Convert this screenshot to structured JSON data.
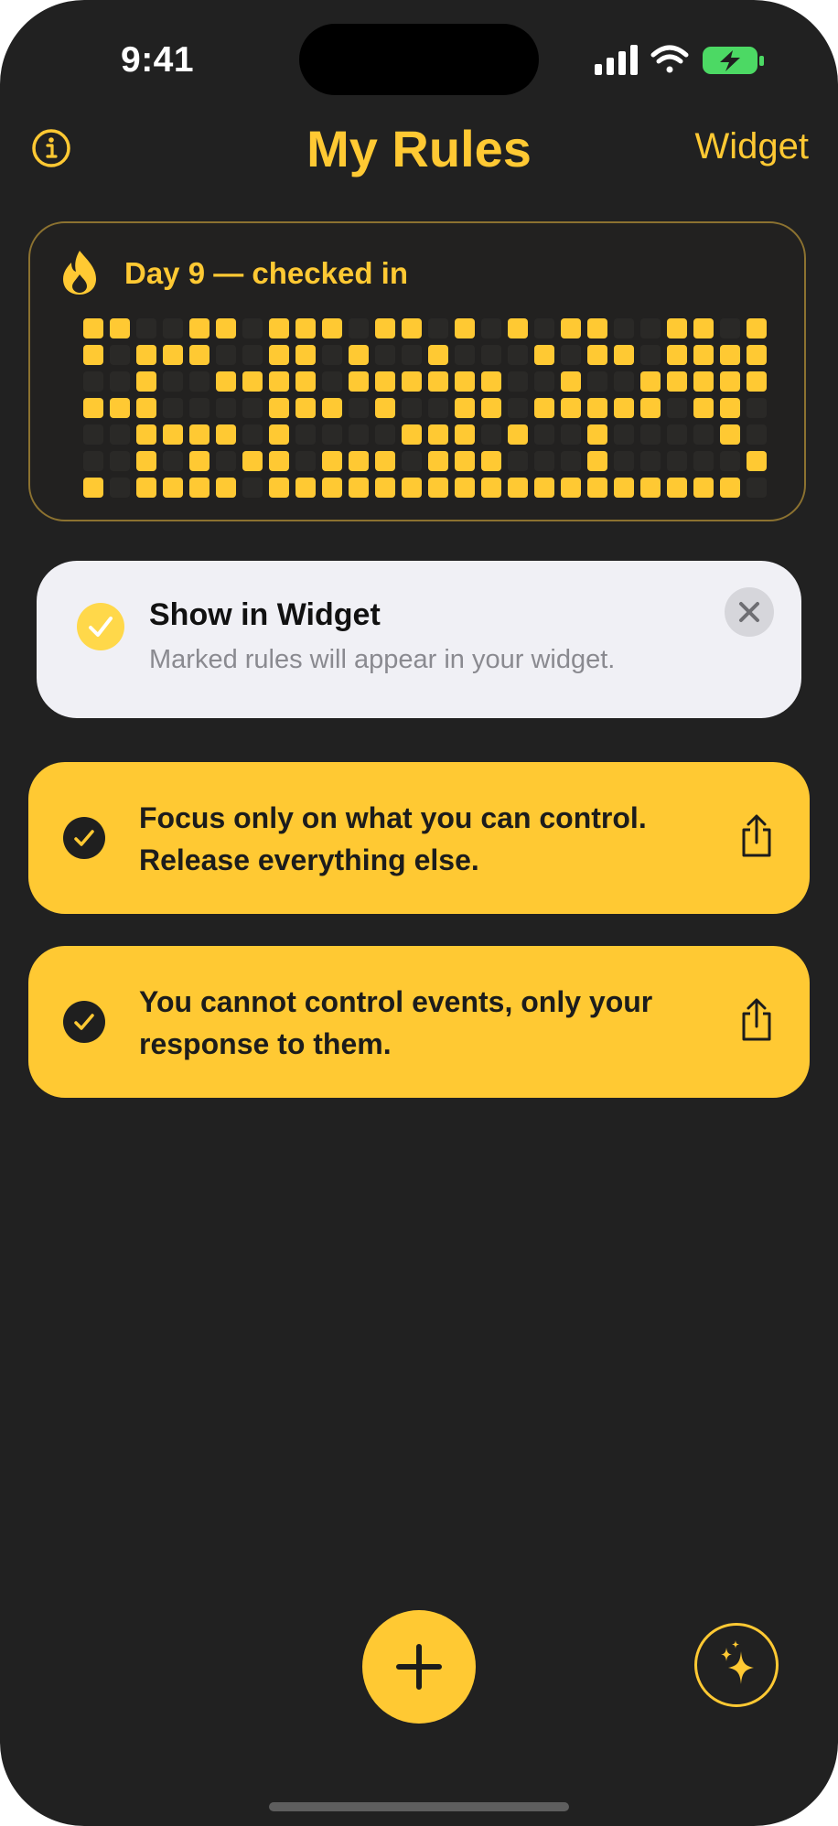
{
  "status_bar": {
    "time": "9:41",
    "icons": [
      "cellular-signal-icon",
      "wifi-icon",
      "battery-charging-icon"
    ]
  },
  "nav": {
    "title": "My Rules",
    "widget_label": "Widget",
    "info_icon": "info-circle-icon"
  },
  "streak": {
    "label": "Day 9 — checked in",
    "icon": "flame-icon",
    "checked_days": 9
  },
  "banner": {
    "title": "Show in Widget",
    "subtitle": "Marked rules will appear in your widget.",
    "icon": "checkmark-circle-icon",
    "close_icon": "close-icon"
  },
  "rules": [
    {
      "text": "Focus only on what you can control. Release everything else.",
      "in_widget": true
    },
    {
      "text": "You cannot control events, only your response to them.",
      "in_widget": true
    }
  ],
  "bottom": {
    "add_icon": "plus-icon",
    "sparkle_icon": "sparkles-icon"
  },
  "colors": {
    "background": "#212121",
    "accent": "#ffc933",
    "banner_bg": "#f0f0f5",
    "battery": "#4cd964"
  }
}
